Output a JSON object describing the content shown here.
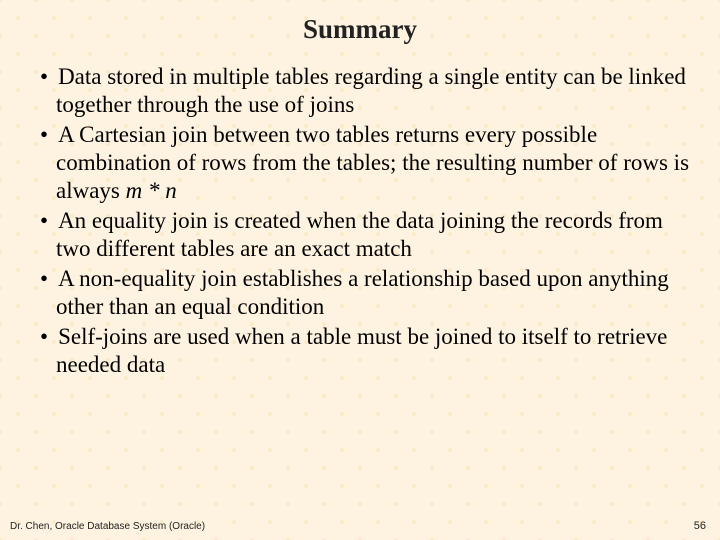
{
  "title": "Summary",
  "bullets": [
    {
      "pre": "Data stored in multiple tables regarding a single entity can be linked together through the use of joins",
      "em": "",
      "post": ""
    },
    {
      "pre": "A Cartesian join between two tables returns every possible combination of rows from the tables; the resulting number of rows is always ",
      "em": "m * n",
      "post": ""
    },
    {
      "pre": "An equality join is created when the data joining the records from two different tables are an exact match",
      "em": "",
      "post": ""
    },
    {
      "pre": "A non-equality join establishes a relationship based upon anything other than an equal condition",
      "em": "",
      "post": ""
    },
    {
      "pre": "Self-joins are used when a table must be joined to itself to retrieve needed data",
      "em": "",
      "post": ""
    }
  ],
  "footer_left": "Dr. Chen, Oracle Database System (Oracle)",
  "footer_right": "56"
}
